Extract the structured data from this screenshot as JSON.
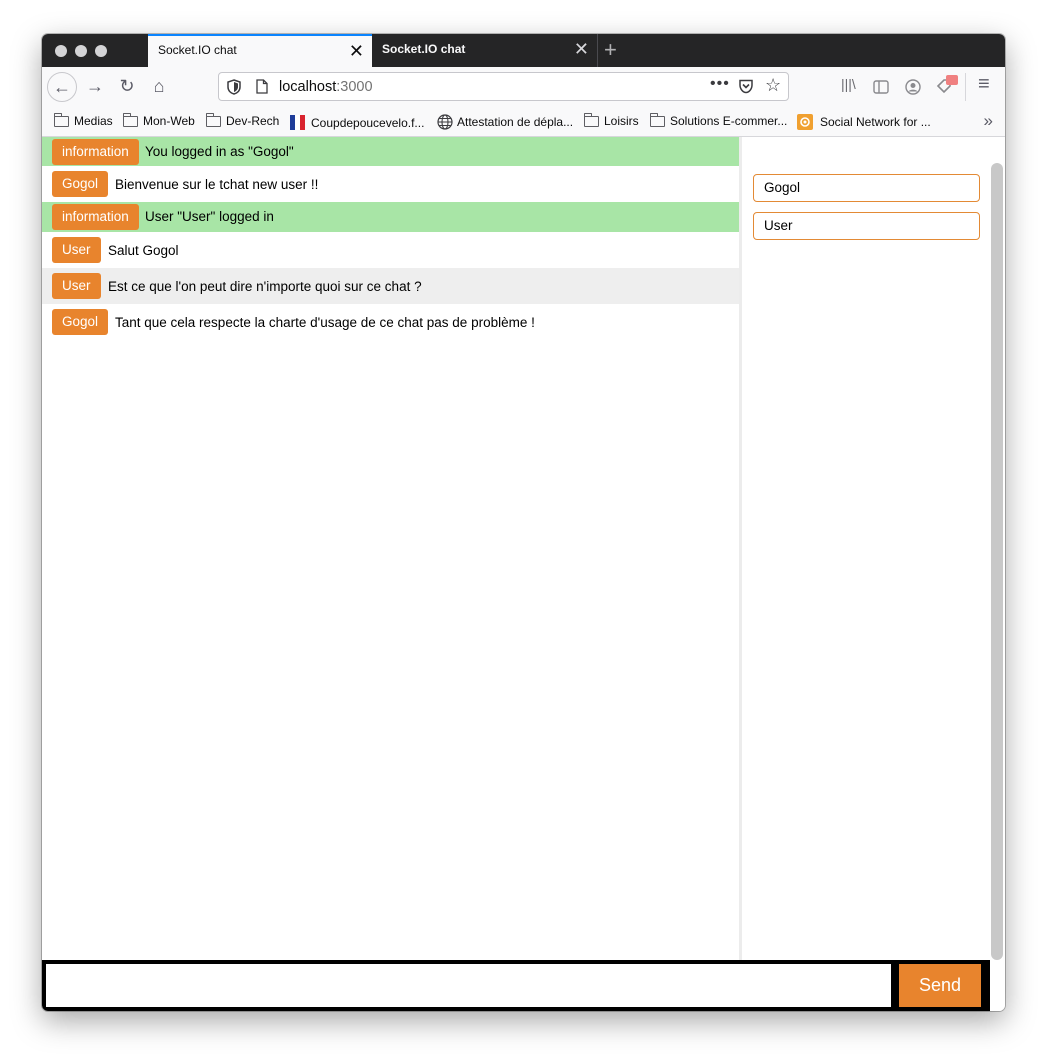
{
  "browser": {
    "tabs": [
      {
        "title": "Socket.IO chat",
        "active": true
      },
      {
        "title": "Socket.IO chat",
        "active": false
      }
    ],
    "url_host": "localhost",
    "url_port": ":3000",
    "bookmarks": [
      {
        "label": "Medias",
        "icon": "folder-icon"
      },
      {
        "label": "Mon-Web",
        "icon": "folder-icon"
      },
      {
        "label": "Dev-Rech",
        "icon": "folder-icon"
      },
      {
        "label": "Coupdepoucevelo.f...",
        "icon": "flag-icon"
      },
      {
        "label": "Attestation de dépla...",
        "icon": "globe-icon"
      },
      {
        "label": "Loisirs",
        "icon": "folder-icon"
      },
      {
        "label": "Solutions E-commer...",
        "icon": "folder-icon"
      },
      {
        "label": "Social Network for ...",
        "icon": "social-icon"
      }
    ]
  },
  "chat": {
    "messages": [
      {
        "sender": "information",
        "text": "You logged in as \"Gogol\"",
        "kind": "info"
      },
      {
        "sender": "Gogol",
        "text": "Bienvenue sur le tchat new user !!",
        "kind": "normal"
      },
      {
        "sender": "information",
        "text": "User \"User\" logged in",
        "kind": "info"
      },
      {
        "sender": "User",
        "text": "Salut Gogol",
        "kind": "normal"
      },
      {
        "sender": "User",
        "text": "Est ce que l'on peut dire n'importe quoi sur ce chat ?",
        "kind": "grey"
      },
      {
        "sender": "Gogol",
        "text": "Tant que cela respecte la charte d'usage de ce chat pas de problème !",
        "kind": "normal"
      }
    ],
    "users": [
      "Gogol",
      "User"
    ],
    "input_value": "",
    "send_label": "Send"
  },
  "colors": {
    "accent_orange": "#e8842d",
    "info_green": "#a8e5a6",
    "highlight_grey": "#eeeeee",
    "tab_active_line": "#0a84ff"
  }
}
